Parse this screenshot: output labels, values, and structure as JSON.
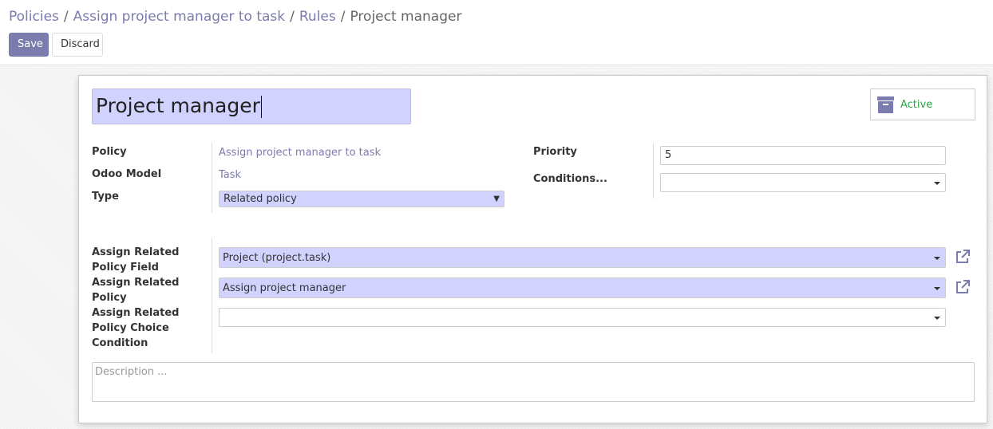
{
  "breadcrumb": {
    "items": [
      "Policies",
      "Assign project manager to task",
      "Rules"
    ],
    "separator": "/",
    "current": "Project manager"
  },
  "toolbar": {
    "save_label": "Save",
    "discard_label": "Discard"
  },
  "record": {
    "name": "Project manager",
    "active_label": "Active",
    "accent_color": "#7c7bad",
    "required_field_color": "#d2d2ff",
    "active_color": "#28a745"
  },
  "fields": {
    "policy": {
      "label": "Policy",
      "value": "Assign project manager to task"
    },
    "odoo_model": {
      "label": "Odoo Model",
      "value": "Task"
    },
    "type": {
      "label": "Type",
      "value": "Related policy"
    },
    "priority": {
      "label": "Priority",
      "value": "5"
    },
    "conditions": {
      "label": "Conditions...",
      "value": ""
    },
    "related_policy_field": {
      "label": "Assign Related Policy Field",
      "value": "Project (project.task)"
    },
    "related_policy": {
      "label": "Assign Related Policy",
      "value": "Assign project manager"
    },
    "related_policy_choice_condition": {
      "label": "Assign Related Policy Choice Condition",
      "value": ""
    }
  },
  "description": {
    "placeholder": "Description ..."
  },
  "icons": {
    "archive": "archive-icon",
    "external_link": "external-link-icon",
    "dropdown": "caret-down-icon"
  }
}
